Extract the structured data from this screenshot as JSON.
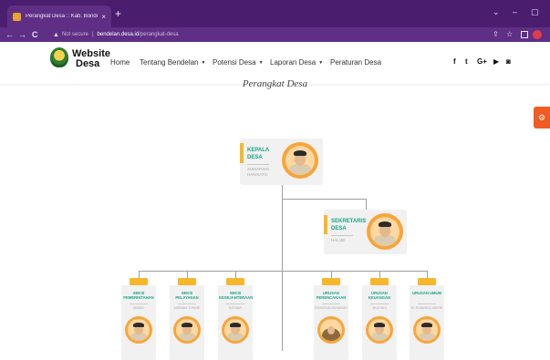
{
  "browser": {
    "tab_title": "Perangkat Desa :: Kab. Bondowo",
    "tab_close": "×",
    "new_tab": "+",
    "url_warning_icon": "▲",
    "url_not_secure": "Not secure",
    "url_separator": "|",
    "url_host": "bendelan.desa.id",
    "url_path": "/perangkat-desa",
    "controls": {
      "minimize": "–",
      "maximize": "▢",
      "chevron": "⌄"
    },
    "nav": {
      "back": "←",
      "forward": "→",
      "reload": "C"
    },
    "right_icons": {
      "share": "⇪",
      "star": "☆"
    }
  },
  "site": {
    "logo": {
      "line1": "Website",
      "line2": "Desa"
    },
    "menu": [
      {
        "label": "Home",
        "has_caret": false
      },
      {
        "label": "Tentang Bendelan",
        "has_caret": true
      },
      {
        "label": "Potensi Desa",
        "has_caret": true
      },
      {
        "label": "Laporan Desa",
        "has_caret": true
      },
      {
        "label": "Peraturan Desa",
        "has_caret": false
      }
    ],
    "caret": "▼",
    "social": {
      "facebook": "f",
      "twitter": "t",
      "google": "G+",
      "youtube": "▶",
      "instagram": "◙"
    }
  },
  "page": {
    "title": "Perangkat Desa",
    "gear_icon": "⚙"
  },
  "org": {
    "kepala": {
      "role_line1": "KEPALA",
      "role_line2": "DESA",
      "name_line1": "SUMARSIO",
      "name_line2": "HAKIKATO"
    },
    "sekretaris": {
      "role_line1": "SEKRETARIS",
      "role_line2": "DESA",
      "name": "HALIJE"
    },
    "staff": [
      {
        "role": "SEKSI PEMERINTAHAN",
        "name": "MISNO"
      },
      {
        "role": "SEKSI PELAYANAN",
        "name": "MISNAM JUHARI"
      },
      {
        "role": "SEKSI KESEJAHTERAAN",
        "name": "SATHAR"
      },
      {
        "role": "URUSAN PERENCANAAN",
        "name": "ROSATUN HASANAH"
      },
      {
        "role": "URUSAN KEUANGAN",
        "name": "MULYADI"
      },
      {
        "role": "URUSAN UMUM",
        "name": "M. SYAMSUL ARIFIN"
      }
    ]
  },
  "colors": {
    "chrome_dark": "#4a1d6e",
    "chrome": "#5e2f85",
    "accent_orange": "#f7a53a",
    "accent_yellow": "#f7b72d",
    "role_teal": "#1aa38a",
    "gear_orange": "#f15a22"
  }
}
